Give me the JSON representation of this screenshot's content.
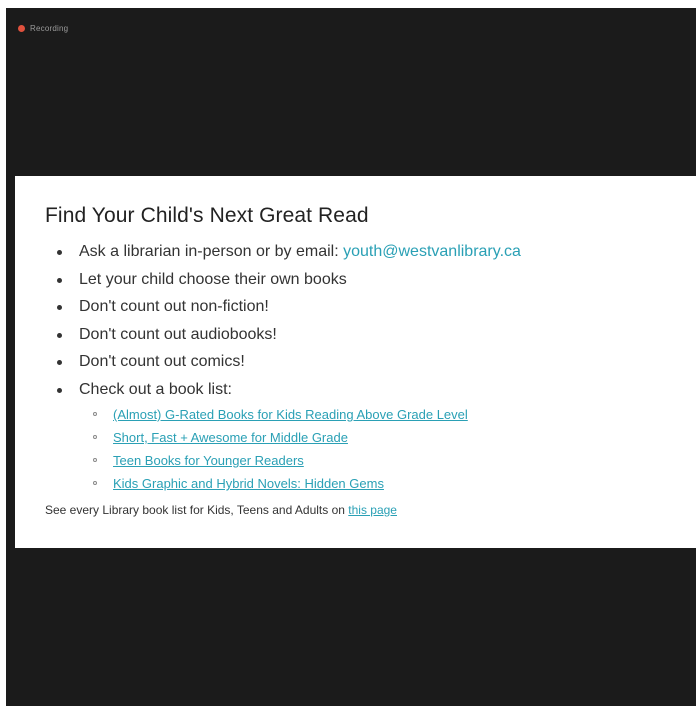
{
  "recording": {
    "label": "Recording"
  },
  "slide": {
    "title": "Find Your Child's Next Great Read",
    "bullets": [
      {
        "text": "Ask a librarian in-person or by email: ",
        "link": "youth@westvanlibrary.ca"
      },
      {
        "text": "Let your child choose their own books"
      },
      {
        "text": "Don't count out non-fiction!"
      },
      {
        "text": "Don't count out audiobooks!"
      },
      {
        "text": "Don't count out comics!"
      },
      {
        "text": "Check out a book list:"
      }
    ],
    "book_lists": [
      "(Almost) G-Rated Books for Kids Reading Above Grade Level",
      "Short, Fast + Awesome for Middle Grade",
      "Teen Books for Younger Readers",
      "Kids Graphic and Hybrid Novels: Hidden Gems"
    ],
    "footer": {
      "text": "See every Library book list for Kids, Teens and Adults on ",
      "link": "this page"
    }
  },
  "colors": {
    "background": "#1b1b1b",
    "slide": "#ffffff",
    "link": "#2aa0b5",
    "record_dot": "#e0513d"
  }
}
